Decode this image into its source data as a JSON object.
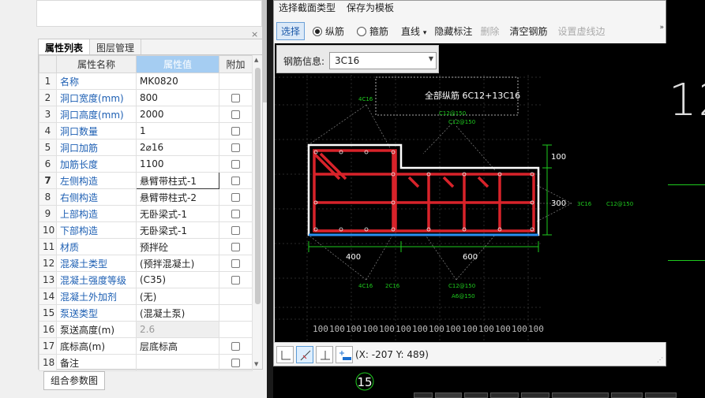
{
  "left_panel": {
    "tabs": [
      "属性列表",
      "图层管理"
    ],
    "close_glyph": "×",
    "columns": [
      "属性名称",
      "属性值",
      "附加"
    ],
    "rows": [
      {
        "idx": "1",
        "name": "名称",
        "value": "MK0820",
        "checkbox": false,
        "black": false
      },
      {
        "idx": "2",
        "name": "洞口宽度(mm)",
        "value": "800",
        "checkbox": true,
        "black": false
      },
      {
        "idx": "3",
        "name": "洞口高度(mm)",
        "value": "2000",
        "checkbox": true,
        "black": false
      },
      {
        "idx": "4",
        "name": "洞口数量",
        "value": "1",
        "checkbox": true,
        "black": false
      },
      {
        "idx": "5",
        "name": "洞口加筋",
        "value": "2⌀16",
        "checkbox": true,
        "black": false
      },
      {
        "idx": "6",
        "name": "加筋长度",
        "value": "1100",
        "checkbox": true,
        "black": false
      },
      {
        "idx": "7",
        "name": "左侧构造",
        "value": "悬臂带柱式-1",
        "checkbox": true,
        "black": false
      },
      {
        "idx": "8",
        "name": "右侧构造",
        "value": "悬臂带柱式-2",
        "checkbox": true,
        "black": false
      },
      {
        "idx": "9",
        "name": "上部构造",
        "value": "无卧梁式-1",
        "checkbox": true,
        "black": false
      },
      {
        "idx": "10",
        "name": "下部构造",
        "value": "无卧梁式-1",
        "checkbox": true,
        "black": false
      },
      {
        "idx": "11",
        "name": "材质",
        "value": "预拌砼",
        "checkbox": true,
        "black": false
      },
      {
        "idx": "12",
        "name": "混凝土类型",
        "value": "(预拌混凝土)",
        "checkbox": true,
        "black": false
      },
      {
        "idx": "13",
        "name": "混凝土强度等级",
        "value": "(C35)",
        "checkbox": true,
        "black": false
      },
      {
        "idx": "14",
        "name": "混凝土外加剂",
        "value": "(无)",
        "checkbox": false,
        "black": false
      },
      {
        "idx": "15",
        "name": "泵送类型",
        "value": "(混凝土泵)",
        "checkbox": false,
        "black": false
      },
      {
        "idx": "16",
        "name": "泵送高度(m)",
        "value": "2.6",
        "checkbox": false,
        "black": true
      },
      {
        "idx": "17",
        "name": "底标高(m)",
        "value": "层底标高",
        "checkbox": true,
        "black": true
      },
      {
        "idx": "18",
        "name": "备注",
        "value": "",
        "checkbox": true,
        "black": true
      }
    ],
    "combo_button": "组合参数图"
  },
  "dialog": {
    "menu": [
      "选择截面类型",
      "保存为模板"
    ],
    "toolbar": {
      "select": "选择",
      "radio_long": "纵筋",
      "radio_stirrup": "箍筋",
      "line": "直线",
      "line_caret": "▾",
      "hide_label": "隐藏标注",
      "delete": "删除",
      "clear": "清空钢筋",
      "virtual_edge": "设置虚线边",
      "more": "»"
    },
    "rebar_info_label": "钢筋信息:",
    "rebar_info_value": "3C16",
    "drawing": {
      "all_long": "全部纵筋 6C12+13C16",
      "lbl_4c16_top": "4C16",
      "lbl_c12_1": "C12@150",
      "lbl_c12_2": "C12@150",
      "dim_100": "100",
      "dim_300": "300",
      "lbl_3c16": "3C16",
      "lbl_c12_right": "C12@150",
      "dim_400": "400",
      "dim_600": "600",
      "lbl_4c16_bot": "4C16",
      "lbl_2c16_bot": "2C16",
      "lbl_c12_bot": "C12@150",
      "lbl_a6_bot": "A6@150",
      "ruler": [
        "100",
        "100",
        "100",
        "100",
        "100",
        "100",
        "100",
        "100",
        "100",
        "100",
        "100",
        "100",
        "100",
        "100"
      ]
    },
    "coords": "(X: -207 Y: 489)"
  },
  "background": {
    "big_text": "12",
    "floor_num": "15"
  },
  "colors": {
    "concrete": "#ffffff",
    "rebar": "#d8232a",
    "dim": "#1ecb1e",
    "label": "#1ecb1e",
    "highlight": "#2a8ff0"
  }
}
